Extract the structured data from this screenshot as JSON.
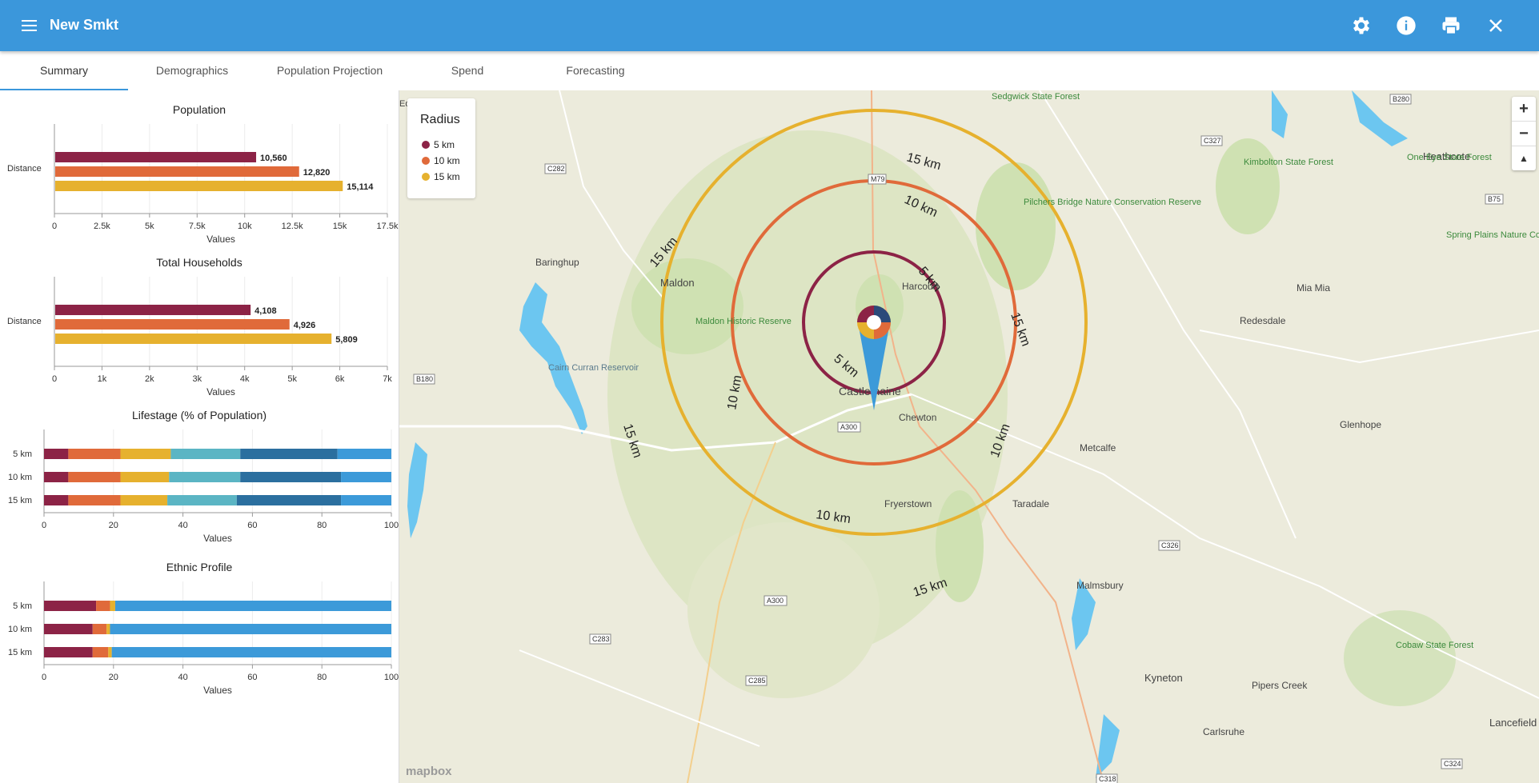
{
  "app": {
    "title": "New Smkt"
  },
  "tabs": [
    {
      "label": "Summary",
      "active": true
    },
    {
      "label": "Demographics"
    },
    {
      "label": "Population Projection"
    },
    {
      "label": "Spend"
    },
    {
      "label": "Forecasting"
    }
  ],
  "icons": {
    "menu": "menu-icon",
    "settings": "gear-icon",
    "info": "info-icon",
    "print": "printer-icon",
    "close": "close-icon"
  },
  "colors": {
    "appbar": "#3b97db",
    "radius_5": "#8c2346",
    "radius_10": "#e06a3a",
    "radius_15": "#e6b12e",
    "teal": "#5bb5c4",
    "navy": "#2b6f9f",
    "blue": "#3c9ad9"
  },
  "chart_data": [
    {
      "type": "bar",
      "title": "Population",
      "category": "Distance",
      "series": [
        {
          "name": "5 km",
          "values": [
            10560
          ],
          "label": "10,560"
        },
        {
          "name": "10 km",
          "values": [
            12820
          ],
          "label": "12,820"
        },
        {
          "name": "15 km",
          "values": [
            15114
          ],
          "label": "15,114"
        }
      ],
      "ticks": [
        "0",
        "2.5k",
        "5k",
        "7.5k",
        "10k",
        "12.5k",
        "15k",
        "17.5k"
      ],
      "xlim": [
        0,
        17500
      ],
      "xlabel": "Values"
    },
    {
      "type": "bar",
      "title": "Total Households",
      "category": "Distance",
      "series": [
        {
          "name": "5 km",
          "values": [
            4108
          ],
          "label": "4,108"
        },
        {
          "name": "10 km",
          "values": [
            4926
          ],
          "label": "4,926"
        },
        {
          "name": "15 km",
          "values": [
            5809
          ],
          "label": "5,809"
        }
      ],
      "ticks": [
        "0",
        "1k",
        "2k",
        "3k",
        "4k",
        "5k",
        "6k",
        "7k"
      ],
      "xlim": [
        0,
        7000
      ],
      "xlabel": "Values"
    },
    {
      "type": "bar",
      "stacked": true,
      "title": "Lifestage (% of Population)",
      "categories": [
        "5 km",
        "10 km",
        "15 km"
      ],
      "segments": [
        [
          7,
          15,
          14.5,
          20,
          28,
          15.5
        ],
        [
          7,
          15,
          14,
          20.5,
          29,
          14.5
        ],
        [
          7,
          15,
          13.5,
          20,
          30,
          14.5
        ]
      ],
      "ticks": [
        "0",
        "20",
        "40",
        "60",
        "80",
        "100"
      ],
      "xlim": [
        0,
        100
      ],
      "xlabel": "Values"
    },
    {
      "type": "bar",
      "stacked": true,
      "title": "Ethnic Profile",
      "categories": [
        "5 km",
        "10 km",
        "15 km"
      ],
      "segments": [
        [
          15,
          4,
          1.5,
          79.5
        ],
        [
          14,
          4,
          1,
          81
        ],
        [
          14,
          4.5,
          1,
          80.5
        ]
      ],
      "ticks": [
        "0",
        "20",
        "40",
        "60",
        "80",
        "100"
      ],
      "xlim": [
        0,
        100
      ],
      "xlabel": "Values"
    }
  ],
  "map": {
    "legend_title": "Radius",
    "legend_items": [
      {
        "label": "5 km",
        "color": "#8c2346"
      },
      {
        "label": "10 km",
        "color": "#e06a3a"
      },
      {
        "label": "15 km",
        "color": "#e6b12e"
      }
    ],
    "ring_label_5": "5 km",
    "ring_label_10": "10 km",
    "ring_label_15": "15 km",
    "center_town": "Castlemaine",
    "places": [
      "Maldon",
      "Harcourt",
      "Chewton",
      "Baringhup",
      "Fryerstown",
      "Taradale",
      "Metcalfe",
      "Malmsbury",
      "Kyneton",
      "Redesdale",
      "Mia Mia",
      "Glenhope",
      "Heathcote",
      "Pipers Creek",
      "Carlsruhe",
      "Lancefield",
      "Cairn Curran Reservoir",
      "Maldon Historic Reserve",
      "Pilchers Bridge Nature Conservation Reserve",
      "Kimbolton State Forest",
      "One Eye State Forest",
      "Spring Plains Nature Conservation Reserve",
      "Cobaw State Forest",
      "Sedgwick State Forest",
      "Ed"
    ],
    "road_labels": [
      "M79",
      "B180",
      "A300",
      "C282",
      "C283",
      "C285",
      "C326",
      "C327",
      "B280",
      "B75",
      "C318",
      "C324",
      "A300"
    ],
    "zoom_in": "+",
    "zoom_out": "−",
    "compass": "▲",
    "attribution": "mapbox"
  }
}
